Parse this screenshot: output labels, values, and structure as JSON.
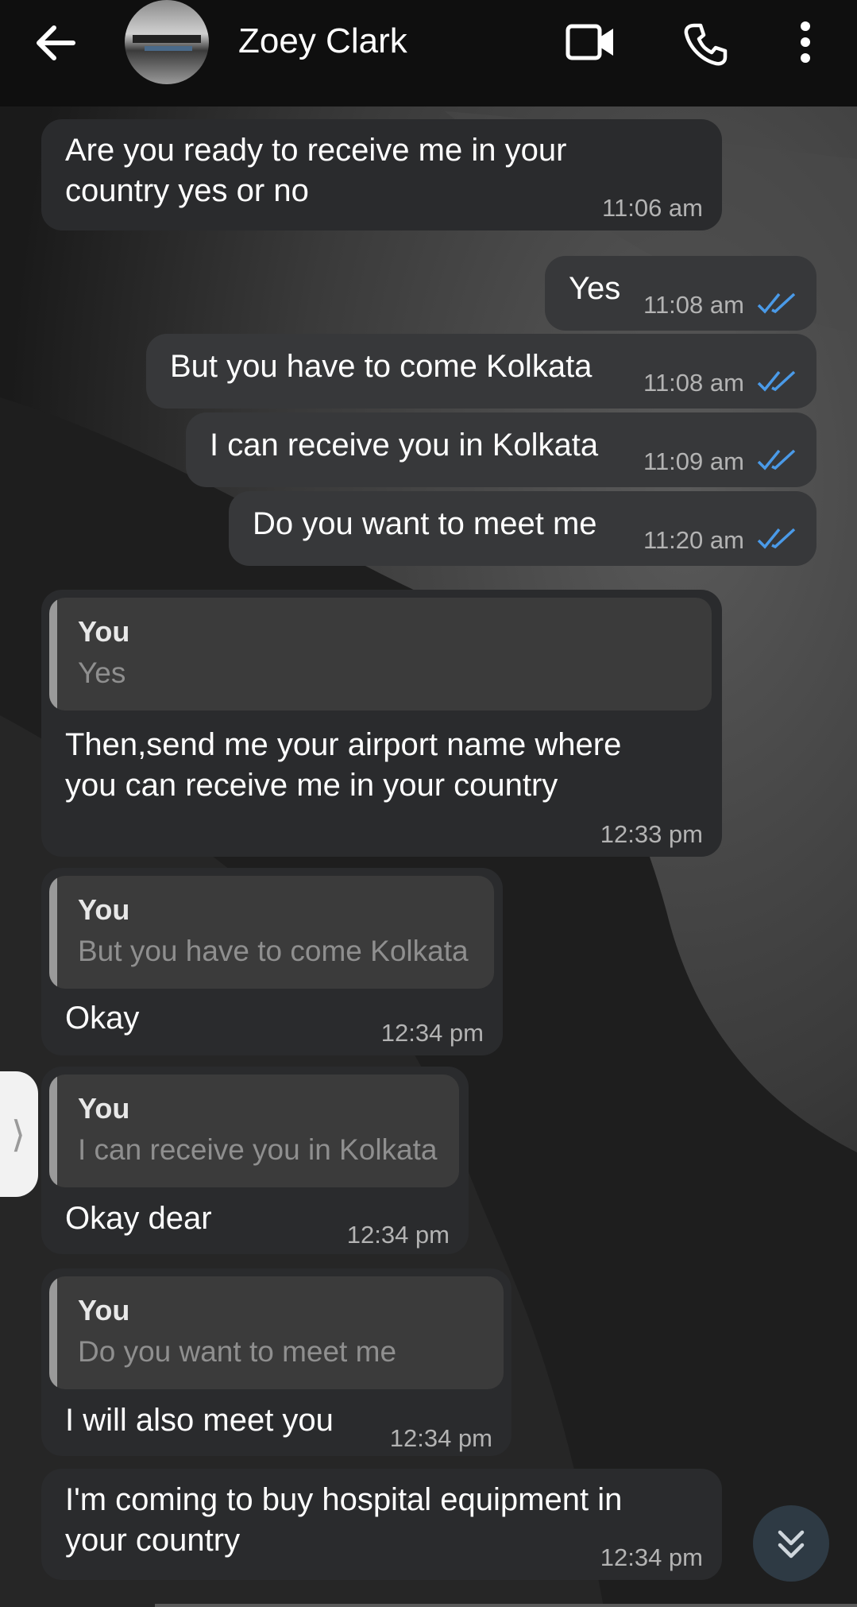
{
  "header": {
    "contact_name": "Zoey Clark",
    "icons": [
      "back-arrow-icon",
      "avatar",
      "video-call-icon",
      "phone-call-icon",
      "more-vert-icon"
    ]
  },
  "messages": [
    {
      "id": "m1",
      "direction": "incoming",
      "lines": [
        "Are you ready to receive me in your",
        "country yes or no"
      ],
      "time": "11:06 am"
    },
    {
      "id": "m2",
      "direction": "outgoing",
      "text": "Yes",
      "time": "11:08 am",
      "status": "read"
    },
    {
      "id": "m3",
      "direction": "outgoing",
      "text": "But you have to come Kolkata",
      "time": "11:08 am",
      "status": "read"
    },
    {
      "id": "m4",
      "direction": "outgoing",
      "text": "I can receive you in Kolkata",
      "time": "11:09 am",
      "status": "read"
    },
    {
      "id": "m5",
      "direction": "outgoing",
      "text": "Do you want to meet me",
      "time": "11:20 am",
      "status": "read"
    },
    {
      "id": "m6",
      "direction": "incoming",
      "quote": {
        "author": "You",
        "text": "Yes"
      },
      "lines": [
        "Then,send me your airport name where",
        "you can receive me in your country"
      ],
      "time": "12:33 pm"
    },
    {
      "id": "m7",
      "direction": "incoming",
      "quote": {
        "author": "You",
        "text": "But you have to come Kolkata"
      },
      "text": "Okay",
      "time": "12:34 pm"
    },
    {
      "id": "m8",
      "direction": "incoming",
      "quote": {
        "author": "You",
        "text": "I can receive you in Kolkata"
      },
      "text": "Okay dear",
      "time": "12:34 pm"
    },
    {
      "id": "m9",
      "direction": "incoming",
      "quote": {
        "author": "You",
        "text": "Do you want to meet me"
      },
      "text": "I will also meet you",
      "time": "12:34 pm"
    },
    {
      "id": "m10",
      "direction": "incoming",
      "lines": [
        "I'm coming to buy hospital equipment in",
        "your country"
      ],
      "time": "12:34 pm"
    }
  ],
  "controls": {
    "side_handle_glyph": "⟩",
    "scroll_down_icon": "double-chevron-down-icon"
  },
  "colors": {
    "read_tick": "#4a9ae8",
    "bubble_in": "#2a2b2d",
    "bubble_out": "#37383a"
  }
}
